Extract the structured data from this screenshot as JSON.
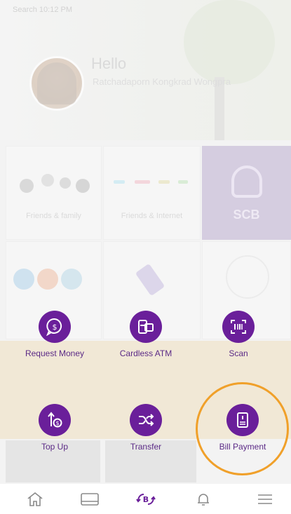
{
  "background": {
    "status_text": "Search 10:12 PM",
    "greeting": "Hello",
    "subname": "Ratchadaporn Kongkrad Wongpra",
    "tiles": [
      {
        "label": "Friends & family"
      },
      {
        "label": "Friends & Internet"
      },
      {
        "label": "SCB"
      }
    ]
  },
  "actions": [
    {
      "label": "Request Money",
      "icon": "coin-bubble-icon"
    },
    {
      "label": "Cardless ATM",
      "icon": "atm-card-icon"
    },
    {
      "label": "Scan",
      "icon": "scan-icon"
    },
    {
      "label": "Top Up",
      "icon": "top-up-icon"
    },
    {
      "label": "Transfer",
      "icon": "transfer-icon"
    },
    {
      "label": "Bill Payment",
      "icon": "bill-icon"
    }
  ],
  "highlighted_action": "Bill Payment",
  "bottom_nav": [
    {
      "icon": "home-icon"
    },
    {
      "icon": "card-icon"
    },
    {
      "icon": "baht-swap-icon"
    },
    {
      "icon": "bell-icon"
    },
    {
      "icon": "menu-icon"
    }
  ],
  "colors": {
    "accent_purple": "#6a1f9a",
    "highlight_orange": "#f0a02a",
    "scb_tile": "#d5cde0"
  }
}
